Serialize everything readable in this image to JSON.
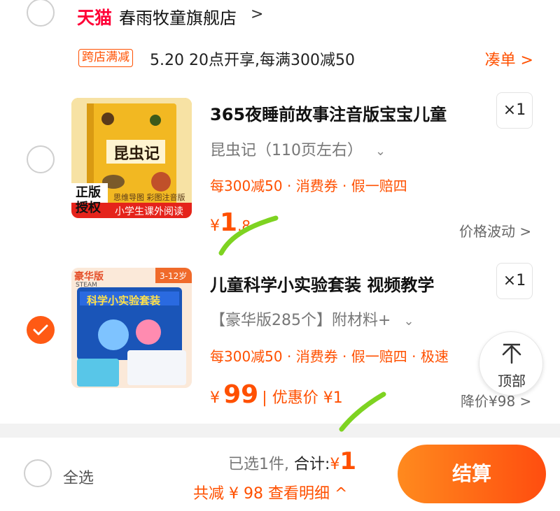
{
  "store": {
    "platform": "天猫",
    "name": "春雨牧童旗舰店",
    "chevron": ">"
  },
  "promo": {
    "tag": "跨店满减",
    "text": "5.20 20点开享,每满300减50",
    "link": "凑单 >"
  },
  "items": [
    {
      "title": "365夜睡前故事注音版宝宝儿童",
      "sku": "昆虫记（110页左右）",
      "tags": "每300减50 · 消费券 · 假一赔四",
      "quantity": "×1",
      "price_currency": "¥",
      "price_int": "1",
      "price_dec": ".8",
      "side_link": "价格波动 >",
      "selected": false,
      "thumb": {
        "badge_top": "正版",
        "badge_bottom": "授权",
        "book_title": "昆虫记",
        "book_sub": "思维导图  彩图注音版",
        "book_strip": "小学生课外阅读"
      }
    },
    {
      "title": "儿童科学小实验套装 视频教学",
      "sku": "【豪华版285个】附材料+",
      "tags": "每300减50 · 消费券 · 假一赔四 · 极速",
      "quantity": "×1",
      "price_currency": "¥",
      "price_int": "99",
      "discount_text": "| 优惠价 ¥1",
      "side_link": "降价¥98 >",
      "selected": true,
      "thumb": {
        "edition": "豪华版",
        "brand": "STEAM",
        "age": "3-12岁",
        "box_title": "科学小实验套装"
      }
    }
  ],
  "to_top": {
    "label": "顶部"
  },
  "footer": {
    "select_all": "全选",
    "selected_count": "已选1件,",
    "total_label": "合计:",
    "total_currency": "¥",
    "total_value": "1",
    "saved": "共减 ¥ 98  查看明细 ^",
    "checkout": "结算"
  },
  "colors": {
    "accent": "#ff5000",
    "tmall": "#ff0036",
    "marker": "#7ed321"
  },
  "icons": {
    "check": "check-icon",
    "up": "arrow-up-icon",
    "chevron": "chevron-down-icon"
  }
}
